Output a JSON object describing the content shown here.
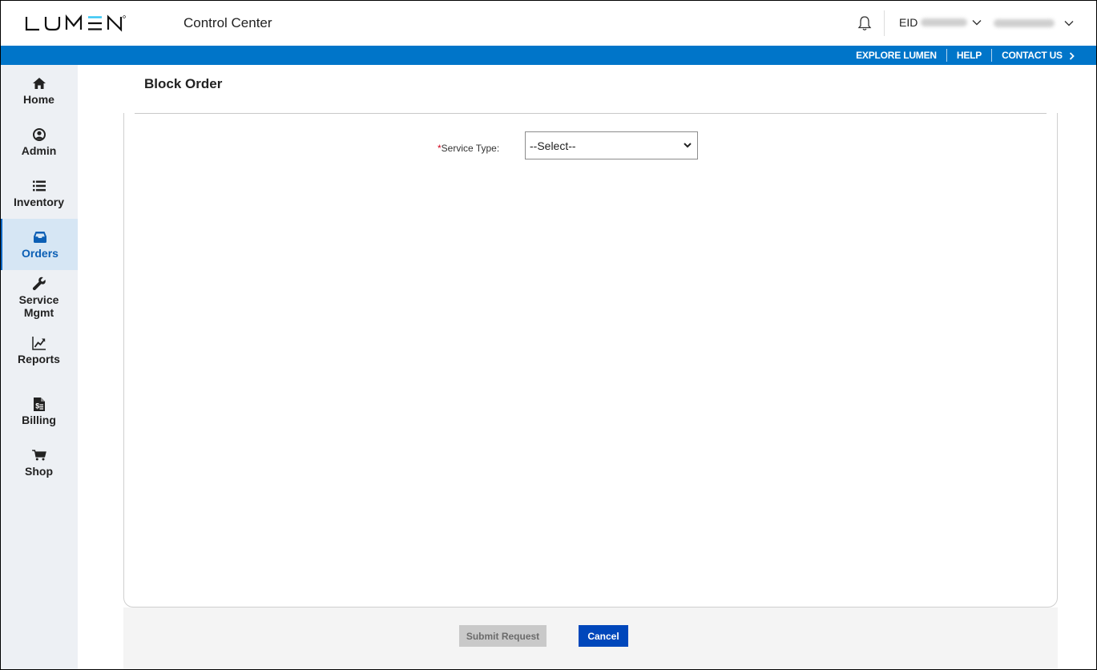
{
  "header": {
    "logo_text": "LUMEN",
    "app_title": "Control Center",
    "notifications_icon": "bell-icon",
    "account_label": "EID",
    "account_value_redacted": true,
    "user_name_redacted": true
  },
  "utility_nav": {
    "links": [
      "EXPLORE LUMEN",
      "HELP",
      "CONTACT US"
    ]
  },
  "sidebar": {
    "active": "Orders",
    "items": [
      {
        "label": "Home",
        "icon": "home-icon"
      },
      {
        "label": "Admin",
        "icon": "user-circle-icon"
      },
      {
        "label": "Inventory",
        "icon": "list-icon"
      },
      {
        "label": "Orders",
        "icon": "inbox-icon"
      },
      {
        "label": "Service Mgmt",
        "icon": "wrench-icon"
      },
      {
        "label": "Reports",
        "icon": "chart-line-icon"
      },
      {
        "label": "Billing",
        "icon": "invoice-icon"
      },
      {
        "label": "Shop",
        "icon": "cart-icon"
      }
    ]
  },
  "main": {
    "page_title": "Block Order",
    "form": {
      "service_type": {
        "required_marker": "*",
        "label": "Service Type:",
        "selected": "--Select--"
      }
    },
    "actions": {
      "submit_label": "Submit Request",
      "submit_disabled": true,
      "cancel_label": "Cancel"
    }
  },
  "colors": {
    "brand_blue_bar": "#0075c9",
    "logo_accent": "#38c6f4",
    "active_nav_bg": "#d6e6f4",
    "active_nav_text": "#0b5fb5",
    "cancel_button": "#0047bb",
    "submit_disabled": "#c9c9c9",
    "required_marker": "#d0021b"
  }
}
